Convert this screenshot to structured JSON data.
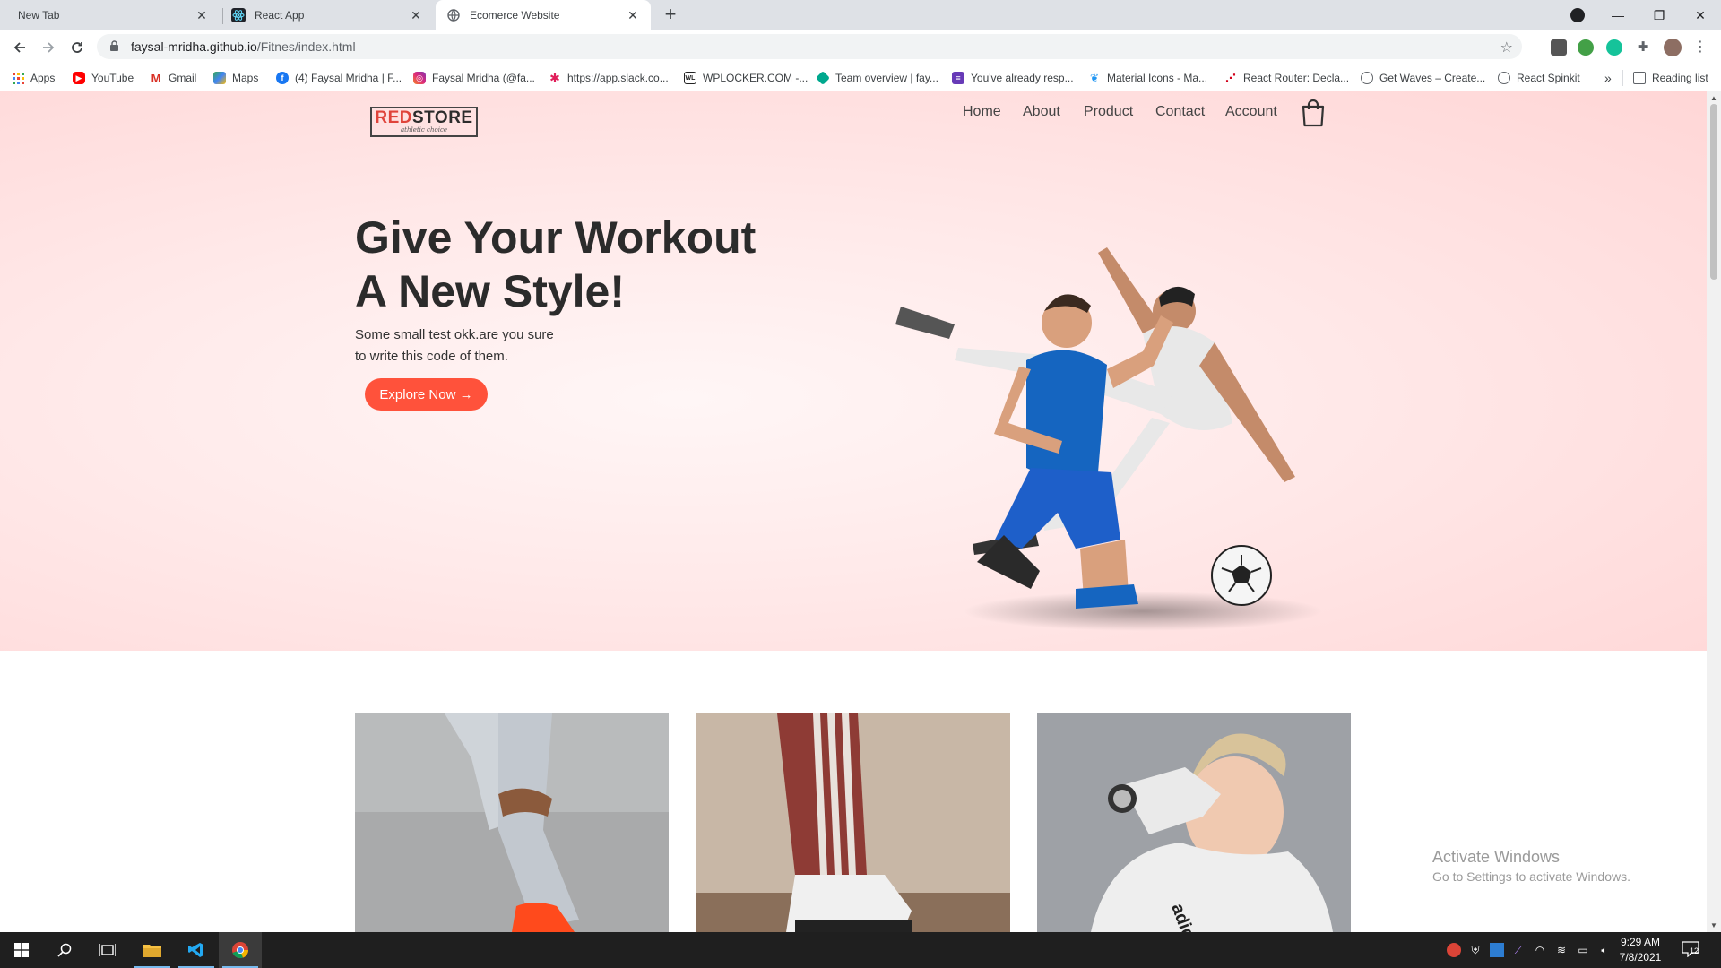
{
  "browser": {
    "tabs": [
      {
        "title": "New Tab",
        "active": false
      },
      {
        "title": "React App",
        "active": false
      },
      {
        "title": "Ecomerce Website",
        "active": true
      }
    ],
    "address_bar": {
      "host": "faysal-mridha.github.io",
      "path": "/Fitnes/index.html"
    },
    "bookmarks": [
      {
        "label": "Apps",
        "icon": "apps-grid-icon",
        "color": "#ea4335"
      },
      {
        "label": "YouTube",
        "icon": "youtube-icon",
        "color": "#ff0000"
      },
      {
        "label": "Gmail",
        "icon": "gmail-icon",
        "color": "#d93025"
      },
      {
        "label": "Maps",
        "icon": "maps-icon",
        "color": "#34a853"
      },
      {
        "label": "(4) Faysal Mridha | F...",
        "icon": "facebook-icon",
        "color": "#1877f2"
      },
      {
        "label": "Faysal Mridha (@fa...",
        "icon": "instagram-icon",
        "color": "#c13584"
      },
      {
        "label": "https://app.slack.co...",
        "icon": "slack-icon",
        "color": "#4a154b"
      },
      {
        "label": "WPLOCKER.COM -...",
        "icon": "wplocker-icon",
        "color": "#222222"
      },
      {
        "label": "Team overview | fay...",
        "icon": "diamond-icon",
        "color": "#00a88e"
      },
      {
        "label": "You've already resp...",
        "icon": "forms-icon",
        "color": "#673ab7"
      },
      {
        "label": "Material Icons - Ma...",
        "icon": "material-icon",
        "color": "#2196f3"
      },
      {
        "label": "React Router: Decla...",
        "icon": "react-router-icon",
        "color": "#d0021b"
      },
      {
        "label": "Get Waves – Create...",
        "icon": "globe-icon",
        "color": "#5f6368"
      },
      {
        "label": "React Spinkit",
        "icon": "globe-icon",
        "color": "#5f6368"
      }
    ],
    "bookmarks_overflow": "»",
    "reading_list": "Reading list"
  },
  "site": {
    "logo": {
      "brand_red": "RED",
      "brand_rest": "STORE",
      "tagline": "athletic choice"
    },
    "menu": [
      "Home",
      "About",
      "Product",
      "Contact",
      "Account"
    ],
    "hero": {
      "headline_line1": "Give Your Workout",
      "headline_line2": "A New Style!",
      "subtext_line1": "Some small test okk.are you sure",
      "subtext_line2": "to write this code of them.",
      "cta": "Explore Now →"
    },
    "accent_color": "#ff523b"
  },
  "watermark": {
    "line1": "Activate Windows",
    "line2": "Go to Settings to activate Windows."
  },
  "taskbar": {
    "time": "9:29 AM",
    "date": "7/8/2021",
    "notifications": "12"
  }
}
